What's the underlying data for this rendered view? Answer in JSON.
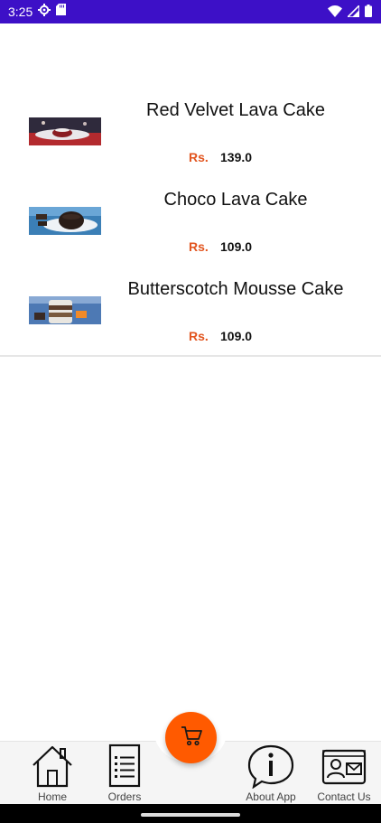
{
  "status_bar": {
    "time": "3:25",
    "background": "#3d10c7"
  },
  "products": [
    {
      "name": "Red Velvet Lava Cake",
      "currency": "Rs.",
      "price": "139.0",
      "image_icon": "red-velvet-cake-photo"
    },
    {
      "name": "Choco Lava Cake",
      "currency": "Rs.",
      "price": "109.0",
      "image_icon": "choco-lava-cake-photo"
    },
    {
      "name": "Butterscotch Mousse Cake",
      "currency": "Rs.",
      "price": "109.0",
      "image_icon": "butterscotch-mousse-photo"
    }
  ],
  "nav": {
    "home": "Home",
    "orders": "Orders",
    "about": "About App",
    "contact": "Contact Us"
  },
  "colors": {
    "accent": "#ff5a00",
    "price_currency": "#e2551f"
  }
}
